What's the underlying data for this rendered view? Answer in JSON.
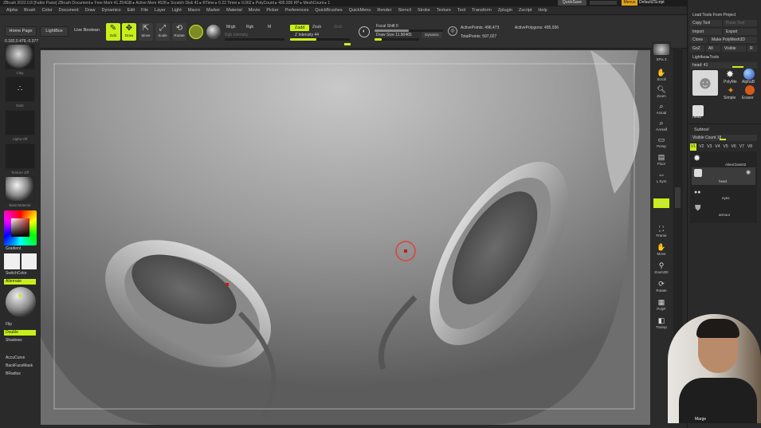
{
  "titlebar": {
    "text": "ZBrush 2022.0.8 [Fabio Pavie]   ZBrush Document     ▸ Free Mem 41.254GB ▸ Active Mem 4528 ▸ Scratch Disk 41 ▸ RTime ▸ 0.22 Timer ▸ 0.062 ▸ PolyCount ▸ 495.936 KP ▸ MeshCount ▸ 1",
    "quicksave": "QuickSave",
    "menus": "Menus",
    "script": "DefaultZScript"
  },
  "menu": [
    "Alpha",
    "Brush",
    "Color",
    "Document",
    "Draw",
    "Dynamics",
    "Edit",
    "File",
    "Layer",
    "Light",
    "Macro",
    "Marker",
    "Material",
    "Movie",
    "Picker",
    "Preferences",
    "QuickBrushes",
    "QuickMenu",
    "Render",
    "Stencil",
    "Stroke",
    "Texture",
    "Tool",
    "Transform",
    "Zplugin",
    "Zscript",
    "Help"
  ],
  "toolbar": {
    "home": "Home Page",
    "lightbox": "LightBox",
    "liveboolean": "Live Boolean",
    "edit": "Edit",
    "draw": "Draw",
    "move": "Move",
    "scale": "Scale",
    "rotate": "Rotate",
    "mrgb": "Mrgb",
    "rgb": "Rgb",
    "m": "M",
    "zadd": "Zadd",
    "zsub": "Zsub",
    "zcut": "Zcut",
    "rgb_intensity": "Rgb Intensity",
    "z_intensity": "Z Intensity 44",
    "focal": "Focal Shift 0",
    "draw_size": "Draw Size 11.90465",
    "dynamic": "Dynamic",
    "active_points": "ActivePoints: 496,473",
    "total_points": "TotalPoints: 597,027",
    "active_polygons": "ActivePolygons: 495,936",
    "z_intensity_level": 0.44
  },
  "left": {
    "coord": "0.182,0.479,-0.377",
    "brush_label": "Clay",
    "stroke_label": "Dots",
    "alpha_label": "Alpha Off",
    "texture_label": "Texture Off",
    "material_label": "BasicMaterial",
    "gradient": "Gradient",
    "switchcolor": "SwitchColor",
    "alternate": "Alternate",
    "flip": "Flip",
    "double": "Double",
    "shadows": "Shadows",
    "accucurve": "AccuCurve",
    "backfacemask": "BackFaceMask",
    "bradius": "BRadius"
  },
  "shelf": [
    "BPR",
    "SPix 3",
    "Scroll",
    "Zoom",
    "Actual",
    "AAHalf",
    "Persp",
    "Floor",
    "L.Sym",
    "Qxyz",
    "Frame",
    "Move",
    "Zoom3D",
    "Rotate",
    "PolyF",
    "Transp",
    "Ghost",
    "Solo"
  ],
  "palette": {
    "load_tools": "Load Tools From Project",
    "copy_tool": "Copy Tool",
    "paste_tool": "Paste Tool",
    "import": "Import",
    "export": "Export",
    "clone": "Clone",
    "make_polymesh": "Make PolyMesh3D",
    "goz": "GoZ",
    "all": "All",
    "visible": "Visible",
    "r": "R",
    "lightbox_tools": "Lightbox▸Tools",
    "head_slider": "head: 41",
    "tool_names": [
      "head",
      "PolyMe",
      "AlphaB",
      "Simple",
      "Eraser",
      "head"
    ],
    "subtool": "Subtool",
    "visible_count": "Visible Count 18",
    "versions": [
      "V1",
      "V2",
      "V3",
      "V4",
      "V5",
      "V6",
      "V7",
      "V8"
    ],
    "subtools": [
      "AlienClass02",
      "head",
      "eyes",
      "armour"
    ]
  },
  "viewport_bg": "#7d7d7d",
  "accent": "#c9ef1a",
  "cursor_color": "#d8443c",
  "webcam_label": "Marge"
}
